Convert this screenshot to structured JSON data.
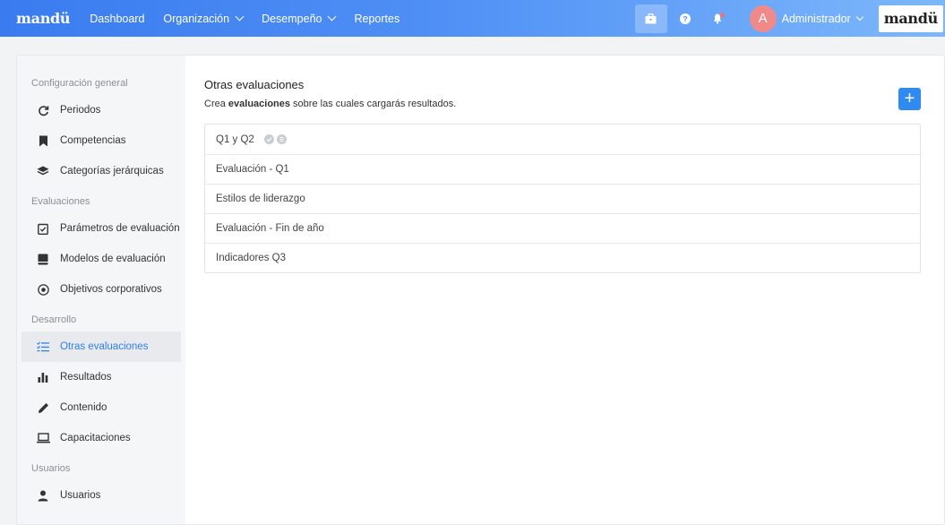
{
  "brand": "mandü",
  "nav": {
    "dashboard": "Dashboard",
    "organizacion": "Organización",
    "desempeno": "Desempeño",
    "reportes": "Reportes"
  },
  "topbar": {
    "icons": [
      "briefcase-icon",
      "help-icon",
      "bell-icon"
    ],
    "avatar_letter": "A",
    "user_name": "Administrador",
    "logo_text": "mandü",
    "colors": {
      "gradient_start": "#3a7bf0",
      "gradient_end": "#7db7fb",
      "avatar": "#f08a8a"
    }
  },
  "sidebar": {
    "sections": [
      {
        "title": "Configuración general",
        "items": [
          {
            "label": "Periodos",
            "icon": "refresh-icon"
          },
          {
            "label": "Competencias",
            "icon": "bookmark-icon"
          },
          {
            "label": "Categorías jerárquicas",
            "icon": "layers-icon"
          }
        ]
      },
      {
        "title": "Evaluaciones",
        "items": [
          {
            "label": "Parámetros de evaluación",
            "icon": "clipboard-check-icon"
          },
          {
            "label": "Modelos de evaluación",
            "icon": "book-icon"
          },
          {
            "label": "Objetivos corporativos",
            "icon": "target-icon"
          }
        ]
      },
      {
        "title": "Desarrollo",
        "items": [
          {
            "label": "Otras evaluaciones",
            "icon": "list-check-icon",
            "active": true
          },
          {
            "label": "Resultados",
            "icon": "bar-chart-icon"
          },
          {
            "label": "Contenido",
            "icon": "pencil-icon"
          },
          {
            "label": "Capacitaciones",
            "icon": "laptop-icon"
          }
        ]
      },
      {
        "title": "Usuarios",
        "items": [
          {
            "label": "Usuarios",
            "icon": "user-icon"
          }
        ]
      }
    ]
  },
  "main": {
    "title": "Otras evaluaciones",
    "subtitle_pre": "Crea ",
    "subtitle_bold": "evaluaciones",
    "subtitle_post": " sobre las cuales cargarás resultados.",
    "add_label": "+",
    "accent": "#2f8bf0",
    "rows": [
      {
        "label": "Q1 y Q2",
        "badges": [
          "check-badge-icon",
          "doc-badge-icon"
        ]
      },
      {
        "label": "Evaluación - Q1"
      },
      {
        "label": "Estilos de liderazgo"
      },
      {
        "label": "Evaluación - Fin de año"
      },
      {
        "label": "Indicadores Q3"
      }
    ]
  }
}
